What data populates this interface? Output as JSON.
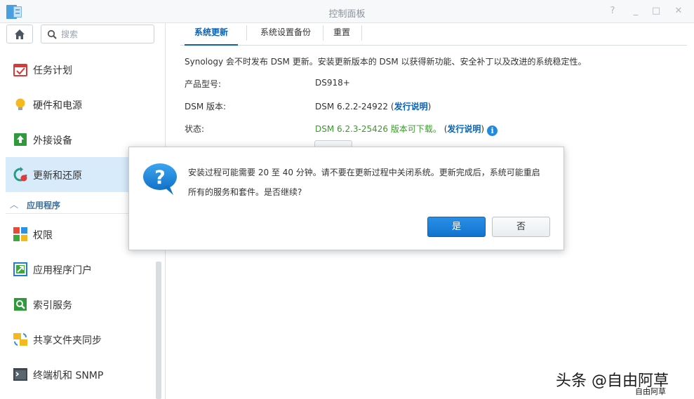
{
  "window": {
    "title": "控制面板"
  },
  "title_buttons": [
    "?",
    "_",
    "□",
    "✕"
  ],
  "search": {
    "placeholder": "搜索"
  },
  "sidebar": {
    "items": [
      {
        "label": "任务计划",
        "icon": "calendar-icon"
      },
      {
        "label": "硬件和电源",
        "icon": "lightbulb-icon"
      },
      {
        "label": "外接设备",
        "icon": "external-device-icon"
      },
      {
        "label": "更新和还原",
        "icon": "update-restore-icon",
        "active": true
      }
    ],
    "section": {
      "label": "应用程序",
      "chevron": "︿"
    },
    "app_items": [
      {
        "label": "权限",
        "icon": "privileges-icon"
      },
      {
        "label": "应用程序门户",
        "icon": "app-portal-icon"
      },
      {
        "label": "索引服务",
        "icon": "indexing-icon"
      },
      {
        "label": "共享文件夹同步",
        "icon": "shared-folder-sync-icon"
      },
      {
        "label": "终端机和 SNMP",
        "icon": "terminal-icon"
      }
    ]
  },
  "tabs": [
    {
      "label": "系统更新",
      "active": true
    },
    {
      "label": "系统设置备份"
    },
    {
      "label": "重置"
    }
  ],
  "content": {
    "description": "Synology 会不时发布 DSM 更新。安装更新版本的 DSM 以获得新功能、安全补丁以及改进的系统稳定性。",
    "model": {
      "label": "产品型号:",
      "value": "DS918+"
    },
    "dsm_version": {
      "label": "DSM 版本:",
      "value": "DSM 6.2.2-24922",
      "link_open": " (",
      "link": "发行说明",
      "link_close": ")"
    },
    "status": {
      "label": "状态:",
      "value": "DSM 6.2.3-25426 版本可下载。",
      "link_open": " (",
      "link": "发行说明",
      "link_close": ")"
    }
  },
  "dialog": {
    "message_line1": "安装过程可能需要 20 至 40 分钟。请不要在更新过程中关闭系统。更新完成后，系统可能重启",
    "message_line2": "所有的服务和套件。是否继续?",
    "yes_label": "是",
    "no_label": "否"
  },
  "watermark": {
    "text": "头条 @自由阿草",
    "small": "自由阿草"
  },
  "colors": {
    "accent": "#0b61b3",
    "active_bg": "#d7ebfb",
    "green": "#3a9a2a",
    "primary_btn": "#1a80dc"
  }
}
